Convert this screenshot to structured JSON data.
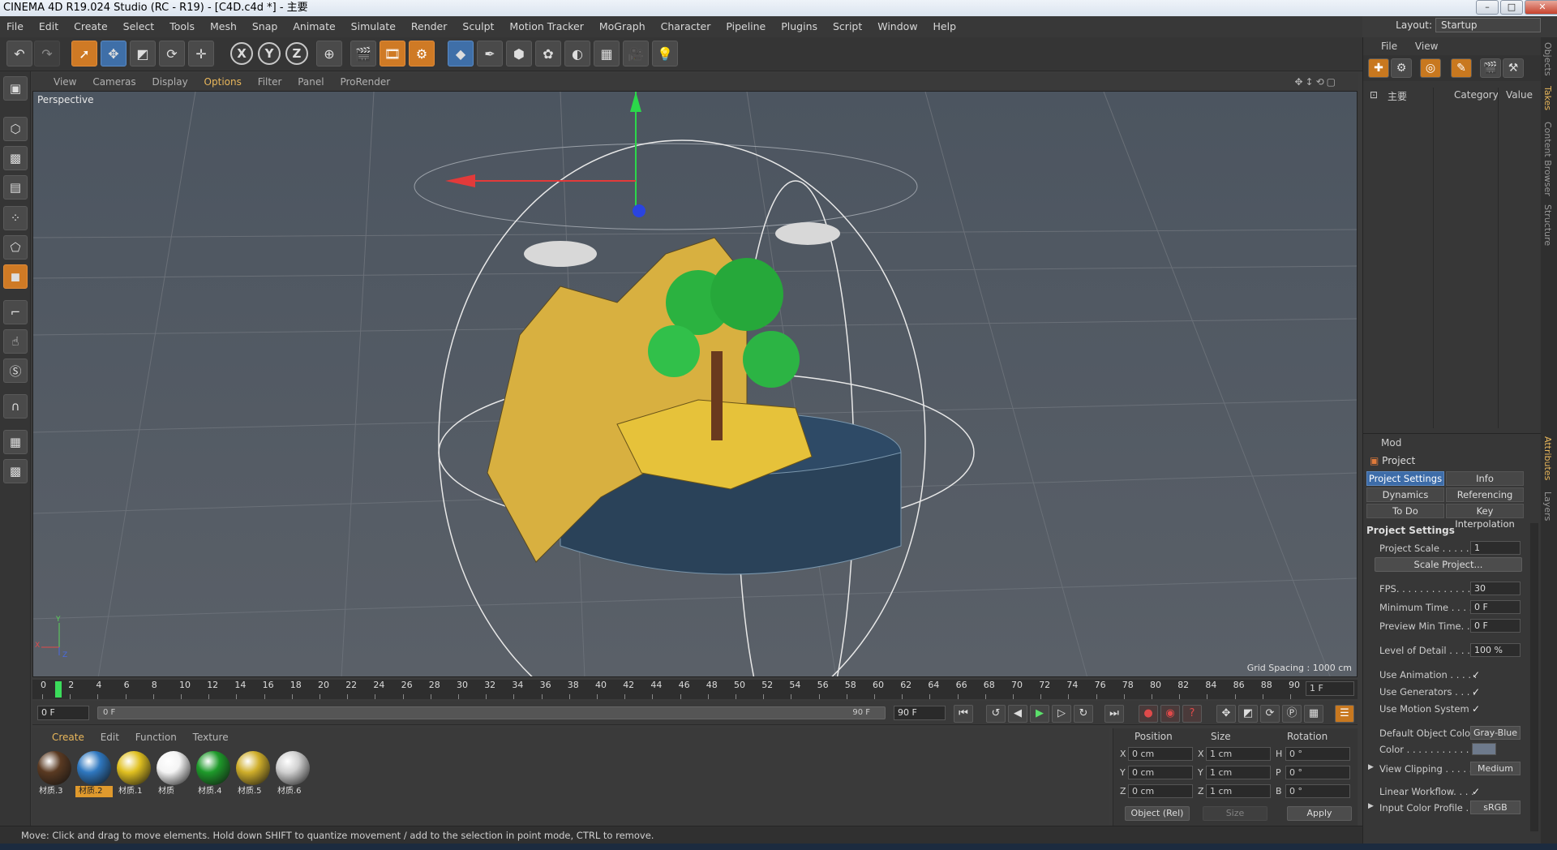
{
  "window": {
    "title": "CINEMA 4D R19.024 Studio (RC - R19) - [C4D.c4d *] - 主要"
  },
  "layout": {
    "label": "Layout:",
    "value": "Startup"
  },
  "menubar": [
    "File",
    "Edit",
    "Create",
    "Select",
    "Tools",
    "Mesh",
    "Snap",
    "Animate",
    "Simulate",
    "Render",
    "Sculpt",
    "Motion Tracker",
    "MoGraph",
    "Character",
    "Pipeline",
    "Plugins",
    "Script",
    "Window",
    "Help"
  ],
  "toolbar": {
    "x_label": "X",
    "y_label": "Y",
    "z_label": "Z"
  },
  "viewport": {
    "menu": [
      "View",
      "Cameras",
      "Display",
      "Options",
      "Filter",
      "Panel",
      "ProRender"
    ],
    "active_menu": "Options",
    "label": "Perspective",
    "grid_spacing": "Grid Spacing : 1000 cm",
    "axis_x": "X",
    "axis_y": "Y",
    "axis_z": "Z"
  },
  "timeline": {
    "ticks": [
      "0",
      "2",
      "4",
      "6",
      "8",
      "10",
      "12",
      "14",
      "16",
      "18",
      "20",
      "22",
      "24",
      "26",
      "28",
      "30",
      "32",
      "34",
      "36",
      "38",
      "40",
      "42",
      "44",
      "46",
      "48",
      "50",
      "52",
      "54",
      "56",
      "58",
      "60",
      "62",
      "64",
      "66",
      "68",
      "70",
      "72",
      "74",
      "76",
      "78",
      "80",
      "82",
      "84",
      "86",
      "88",
      "90"
    ],
    "current_frame": "1 F",
    "playhead_label": "2"
  },
  "transport": {
    "start": "0 F",
    "range_start": "0 F",
    "range_end": "90 F",
    "end": "90 F"
  },
  "materials": {
    "menu": [
      "Create",
      "Edit",
      "Function",
      "Texture"
    ],
    "active_menu": "Create",
    "items": [
      {
        "name": "材质.3",
        "color": "#5a3a22"
      },
      {
        "name": "材质.2",
        "color": "#2f78c0",
        "selected": true
      },
      {
        "name": "材质.1",
        "color": "#e0c020"
      },
      {
        "name": "材质",
        "color": "#f4f4f4"
      },
      {
        "name": "材质.4",
        "color": "#1e9a2a"
      },
      {
        "name": "材质.5",
        "color": "#cfae2a"
      },
      {
        "name": "材质.6",
        "color": "#d0d0d0"
      }
    ]
  },
  "coords": {
    "headers": {
      "position": "Position",
      "size": "Size",
      "rotation": "Rotation"
    },
    "rows": [
      {
        "a": "X",
        "pos": "0 cm",
        "b": "X",
        "size": "1 cm",
        "c": "H",
        "rot": "0 °"
      },
      {
        "a": "Y",
        "pos": "0 cm",
        "b": "Y",
        "size": "1 cm",
        "c": "P",
        "rot": "0 °"
      },
      {
        "a": "Z",
        "pos": "0 cm",
        "b": "Z",
        "size": "1 cm",
        "c": "B",
        "rot": "0 °"
      }
    ],
    "mode": "Object (Rel)",
    "size_mode": "Size",
    "apply": "Apply"
  },
  "status": "Move: Click and drag to move elements. Hold down SHIFT to quantize movement / add to the selection in point mode, CTRL to remove.",
  "takes": {
    "menu": [
      "File",
      "View"
    ],
    "root": "主要",
    "col_category": "Category",
    "col_value": "Value"
  },
  "attributes": {
    "menu": "Mod",
    "title": "Project",
    "tabs": [
      "Project Settings",
      "Info",
      "Dynamics",
      "Referencing",
      "To Do",
      "Key Interpolation"
    ],
    "section": "Project Settings",
    "project_scale_label": "Project Scale . . . . . .",
    "project_scale": "1",
    "scale_project": "Scale Project...",
    "fps_label": "FPS. . . . . . . . . . . . . .",
    "fps": "30",
    "min_time_label": "Minimum Time . . . . .",
    "min_time": "0 F",
    "preview_min_label": "Preview Min Time. . .",
    "preview_min": "0 F",
    "lod_label": "Level of Detail . . . . .",
    "lod": "100 %",
    "use_animation": "Use Animation . . . . .",
    "use_generators": "Use Generators . . . .",
    "use_motion": "Use Motion System",
    "default_color_label": "Default Object Color",
    "default_color": "Gray-Blue",
    "color_label": "Color . . . . . . . . . . .",
    "view_clipping_label": "View Clipping . . . . .",
    "view_clipping": "Medium",
    "linear_workflow": "Linear Workflow. . . .",
    "input_profile_label": "Input Color Profile . .",
    "input_profile": "sRGB"
  },
  "sidetabs": [
    "Objects",
    "Takes",
    "Content Browser",
    "Structure",
    "Attributes",
    "Layers"
  ]
}
